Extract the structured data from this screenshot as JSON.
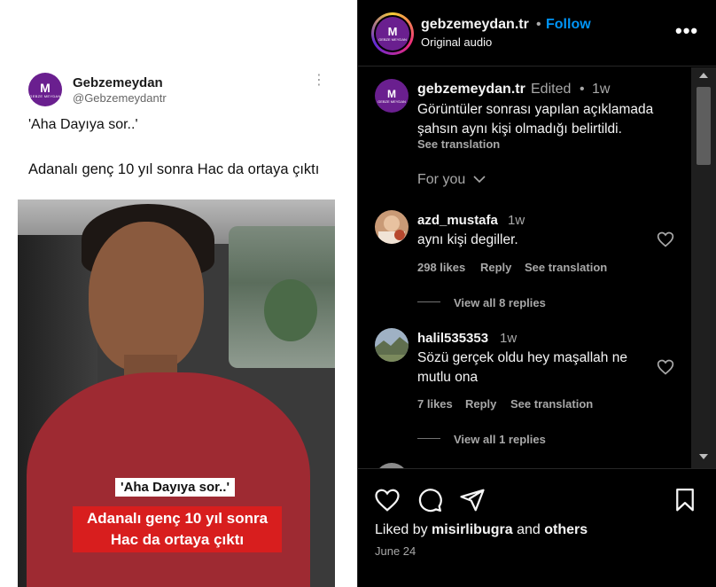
{
  "media": {
    "tweet": {
      "name": "Gebzemeydan",
      "handle": "@Gebzemeydantr",
      "avatar_letter": "M",
      "avatar_subtext": "GEBZE MEYDAN",
      "more_icon": "⋮",
      "text_line1": "'Aha Dayıya sor..'",
      "text_line2": "Adanalı genç 10 yıl sonra Hac da ortaya çıktı"
    },
    "video": {
      "caption_top": "'Aha Dayıya sor..'",
      "caption_bottom": "Adanalı genç 10 yıl sonra Hac da ortaya çıktı"
    }
  },
  "header": {
    "username": "gebzemeydan.tr",
    "separator": "•",
    "follow_label": "Follow",
    "audio": "Original audio",
    "more_label": "•••"
  },
  "caption": {
    "username": "gebzemeydan.tr",
    "edited": "Edited",
    "dot": "•",
    "time": "1w",
    "text": "Görüntüler sonrası yapılan açıklamada şahsın aynı kişi olmadığı belirtildi.",
    "see_translation": "See translation"
  },
  "filter": {
    "label": "For you"
  },
  "comments": [
    {
      "username": "azd_mustafa",
      "time": "1w",
      "text": "aynı kişi degiller.",
      "likes": "298 likes",
      "reply": "Reply",
      "see_translation": "See translation",
      "view_replies": "View all 8 replies"
    },
    {
      "username": "halil535353",
      "time": "1w",
      "text": "Sözü gerçek oldu hey maşallah ne mutlu ona",
      "likes": "7 likes",
      "reply": "Reply",
      "see_translation": "See translation",
      "view_replies": "View all 1 replies"
    }
  ],
  "footer": {
    "liked_by_prefix": "Liked by",
    "liked_by_user": "misirlibugra",
    "liked_by_and": "and",
    "liked_by_others": "others",
    "date": "June 24"
  },
  "icons": {
    "like": "heart-icon",
    "comment": "comment-icon",
    "share": "send-icon",
    "save": "bookmark-icon"
  },
  "colors": {
    "follow": "#0095f6",
    "brand_purple": "#6a1f8f",
    "caption_red": "#d81e1e"
  }
}
